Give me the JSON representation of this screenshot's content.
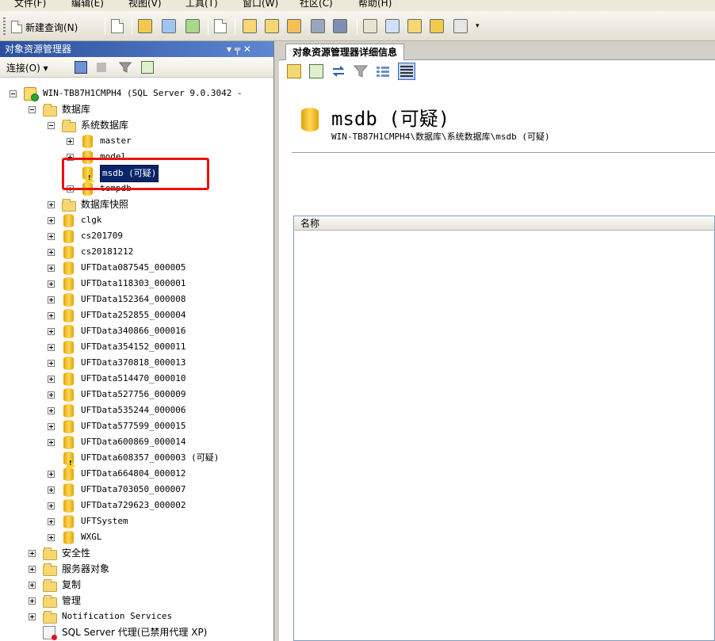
{
  "menubar": {
    "items": [
      "文件(F)",
      "编辑(E)",
      "视图(V)",
      "工具(T)",
      "窗口(W)",
      "社区(C)",
      "帮助(H)"
    ]
  },
  "toolbar": {
    "new_query_label": "新建查询(N)"
  },
  "object_explorer": {
    "title": "对象资源管理器",
    "pin_glyph": "▾ ╤ ✕",
    "connect_label": "连接(O) ▾",
    "tree": [
      {
        "level": 0,
        "expander": "minus",
        "icon": "server-icon",
        "label": "WIN-TB87H1CMPH4 (SQL Server 9.0.3042 -",
        "mono": true
      },
      {
        "level": 1,
        "expander": "minus",
        "icon": "folder-icon",
        "label": "数据库"
      },
      {
        "level": 2,
        "expander": "minus",
        "icon": "folder-icon",
        "label": "系统数据库"
      },
      {
        "level": 3,
        "expander": "plus",
        "icon": "database-icon",
        "label": "master",
        "mono": true
      },
      {
        "level": 3,
        "expander": "plus",
        "icon": "database-icon",
        "label": "model",
        "mono": true
      },
      {
        "level": 3,
        "expander": "none",
        "icon": "database-warning-icon",
        "label": "msdb (可疑)",
        "mono": true,
        "selected": true
      },
      {
        "level": 3,
        "expander": "plus",
        "icon": "database-icon",
        "label": "tempdb",
        "mono": true
      },
      {
        "level": 2,
        "expander": "plus",
        "icon": "folder-icon",
        "label": "数据库快照"
      },
      {
        "level": 2,
        "expander": "plus",
        "icon": "database-icon",
        "label": "clgk",
        "mono": true
      },
      {
        "level": 2,
        "expander": "plus",
        "icon": "database-icon",
        "label": "cs201709",
        "mono": true
      },
      {
        "level": 2,
        "expander": "plus",
        "icon": "database-icon",
        "label": "cs20181212",
        "mono": true
      },
      {
        "level": 2,
        "expander": "plus",
        "icon": "database-icon",
        "label": "UFTData087545_000005",
        "mono": true
      },
      {
        "level": 2,
        "expander": "plus",
        "icon": "database-icon",
        "label": "UFTData118303_000001",
        "mono": true
      },
      {
        "level": 2,
        "expander": "plus",
        "icon": "database-icon",
        "label": "UFTData152364_000008",
        "mono": true
      },
      {
        "level": 2,
        "expander": "plus",
        "icon": "database-icon",
        "label": "UFTData252855_000004",
        "mono": true
      },
      {
        "level": 2,
        "expander": "plus",
        "icon": "database-icon",
        "label": "UFTData340866_000016",
        "mono": true
      },
      {
        "level": 2,
        "expander": "plus",
        "icon": "database-icon",
        "label": "UFTData354152_000011",
        "mono": true
      },
      {
        "level": 2,
        "expander": "plus",
        "icon": "database-icon",
        "label": "UFTData370818_000013",
        "mono": true
      },
      {
        "level": 2,
        "expander": "plus",
        "icon": "database-icon",
        "label": "UFTData514470_000010",
        "mono": true
      },
      {
        "level": 2,
        "expander": "plus",
        "icon": "database-icon",
        "label": "UFTData527756_000009",
        "mono": true
      },
      {
        "level": 2,
        "expander": "plus",
        "icon": "database-icon",
        "label": "UFTData535244_000006",
        "mono": true
      },
      {
        "level": 2,
        "expander": "plus",
        "icon": "database-icon",
        "label": "UFTData577599_000015",
        "mono": true
      },
      {
        "level": 2,
        "expander": "plus",
        "icon": "database-icon",
        "label": "UFTData600869_000014",
        "mono": true
      },
      {
        "level": 2,
        "expander": "none",
        "icon": "database-warning-icon",
        "label": "UFTData608357_000003 (可疑)",
        "mono": true
      },
      {
        "level": 2,
        "expander": "plus",
        "icon": "database-icon",
        "label": "UFTData664804_000012",
        "mono": true
      },
      {
        "level": 2,
        "expander": "plus",
        "icon": "database-icon",
        "label": "UFTData703050_000007",
        "mono": true
      },
      {
        "level": 2,
        "expander": "plus",
        "icon": "database-icon",
        "label": "UFTData729623_000002",
        "mono": true
      },
      {
        "level": 2,
        "expander": "plus",
        "icon": "database-icon",
        "label": "UFTSystem",
        "mono": true
      },
      {
        "level": 2,
        "expander": "plus",
        "icon": "database-icon",
        "label": "WXGL",
        "mono": true
      },
      {
        "level": 1,
        "expander": "plus",
        "icon": "folder-icon",
        "label": "安全性"
      },
      {
        "level": 1,
        "expander": "plus",
        "icon": "folder-icon",
        "label": "服务器对象"
      },
      {
        "level": 1,
        "expander": "plus",
        "icon": "folder-icon",
        "label": "复制"
      },
      {
        "level": 1,
        "expander": "plus",
        "icon": "folder-icon",
        "label": "管理"
      },
      {
        "level": 1,
        "expander": "plus",
        "icon": "folder-icon",
        "label": "Notification Services",
        "mono": true
      },
      {
        "level": 1,
        "expander": "none",
        "icon": "agent-icon",
        "label": "SQL Server 代理(已禁用代理 XP)"
      }
    ]
  },
  "details": {
    "tab_label": "对象资源管理器详细信息",
    "db_title": "msdb (可疑)",
    "db_path": "WIN-TB87H1CMPH4\\数据库\\系统数据库\\msdb (可疑)",
    "list_column_name": "名称"
  },
  "colors": {
    "highlight_box": "#e11111",
    "selection": "#0a246a",
    "db_gold": "#e0a400"
  }
}
